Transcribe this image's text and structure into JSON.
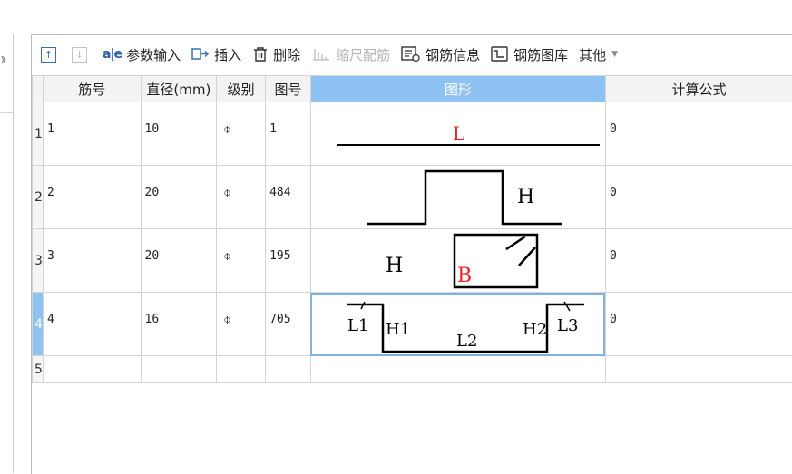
{
  "toolbar": {
    "move_up_label": "",
    "move_down_label": "",
    "param_input_icon_text": "a|e",
    "param_input_label": "参数输入",
    "insert_label": "插入",
    "delete_label": "删除",
    "scale_label": "缩尺配筋",
    "rebar_info_label": "钢筋信息",
    "rebar_library_label": "钢筋图库",
    "other_label": "其他"
  },
  "table": {
    "headers": {
      "bar_no": "筋号",
      "diameter": "直径(mm)",
      "grade": "级别",
      "shape_no": "图号",
      "shape": "图形",
      "formula": "计算公式"
    },
    "rows": [
      {
        "row": "1",
        "bar_no": "1",
        "diameter": "10",
        "grade": "⌽",
        "shape_no": "1",
        "formula": "0",
        "labels": {
          "a": "L"
        }
      },
      {
        "row": "2",
        "bar_no": "2",
        "diameter": "20",
        "grade": "⌽",
        "shape_no": "484",
        "formula": "0",
        "labels": {
          "a": "H"
        }
      },
      {
        "row": "3",
        "bar_no": "3",
        "diameter": "20",
        "grade": "⌽",
        "shape_no": "195",
        "formula": "0",
        "labels": {
          "a": "H",
          "b": "B"
        }
      },
      {
        "row": "4",
        "bar_no": "4",
        "diameter": "16",
        "grade": "⌽",
        "shape_no": "705",
        "formula": "0",
        "labels": {
          "l1": "L1",
          "h1": "H1",
          "l2": "L2",
          "h2": "H2",
          "l3": "L3"
        }
      },
      {
        "row": "5",
        "bar_no": "",
        "diameter": "",
        "grade": "",
        "shape_no": "",
        "formula": ""
      }
    ]
  },
  "colors": {
    "accent": "#8ec2f2",
    "label_red": "#e8272d",
    "icon_blue": "#3a6fb0"
  }
}
